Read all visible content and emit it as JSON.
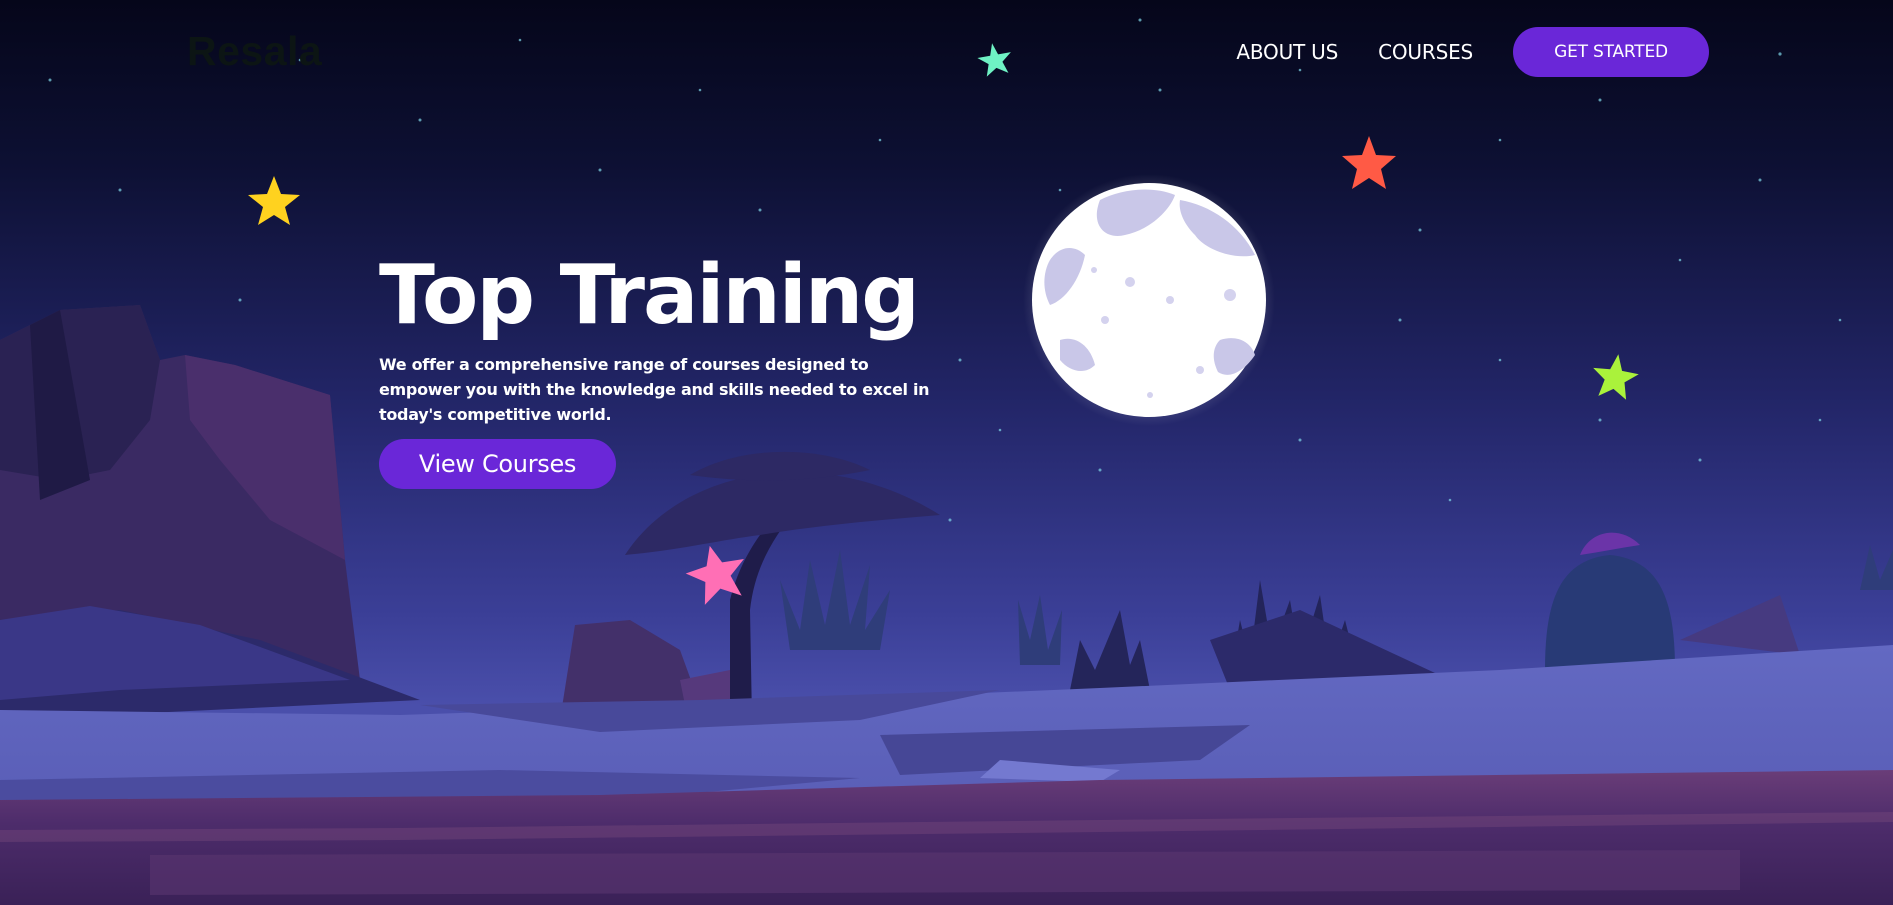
{
  "brand": {
    "logo_text": "Resala"
  },
  "nav": {
    "items": [
      {
        "label": "ABOUT US"
      },
      {
        "label": "COURSES"
      }
    ],
    "cta_label": "GET STARTED"
  },
  "hero": {
    "title": "Top Training",
    "description": "We offer a comprehensive range of courses designed to empower you with the knowledge and skills needed to excel in today's competitive world.",
    "button_label": "View Courses"
  },
  "colors": {
    "accent": "#6a27d8",
    "sky_top": "#05061a",
    "sky_bottom": "#3b3f97",
    "ground": "#5c62bb",
    "star_yellow": "#ffd21f",
    "star_red": "#ff5a45",
    "star_green": "#aaf23b",
    "star_teal": "#6ff2c4",
    "star_pink": "#ff6fb5"
  },
  "icons": [
    "star-yellow-icon",
    "star-red-icon",
    "star-lime-icon",
    "star-teal-icon",
    "star-pink-icon",
    "moon-illustration"
  ]
}
